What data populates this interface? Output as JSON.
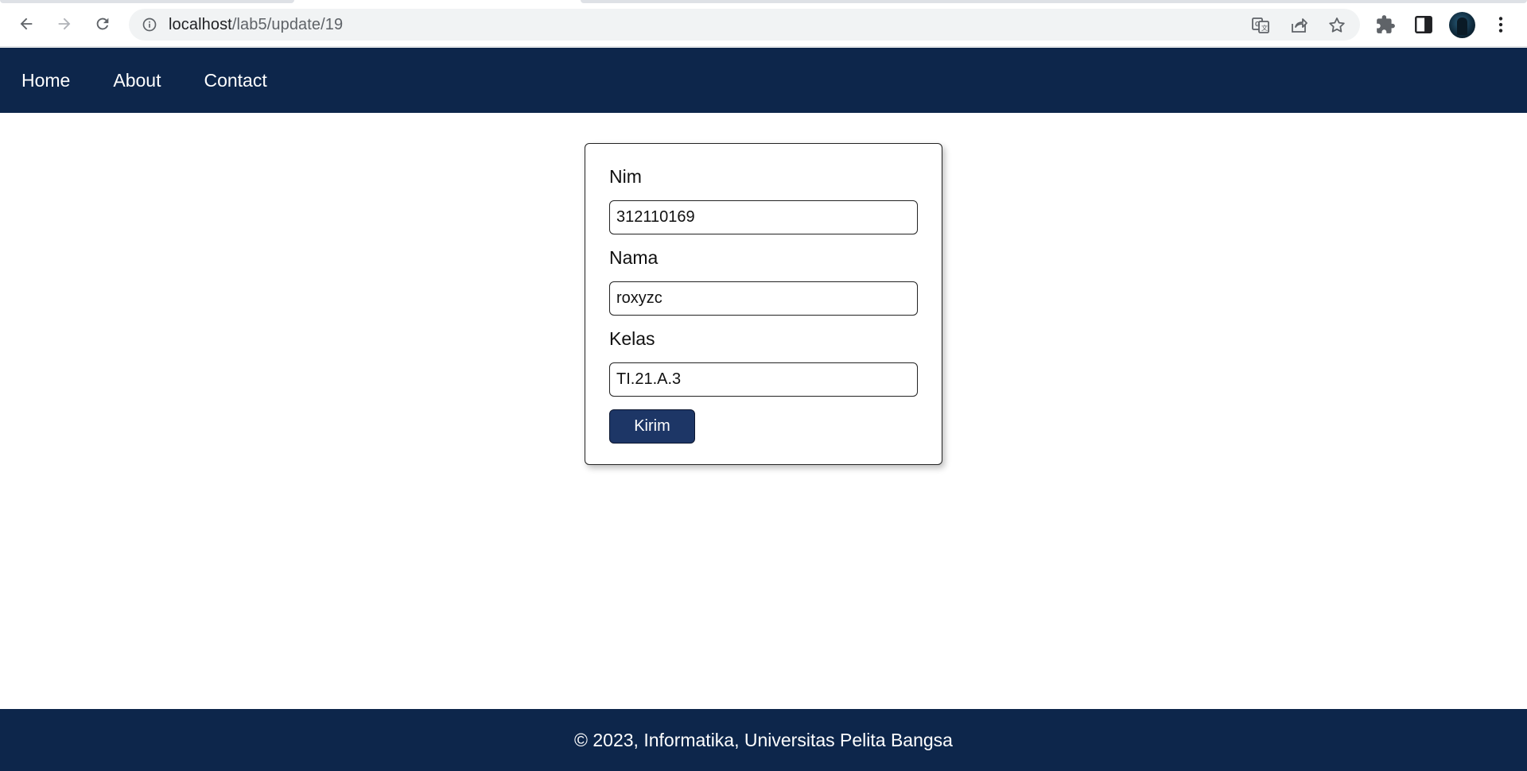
{
  "browser": {
    "url_host": "localhost",
    "url_path": "/lab5/update/19",
    "icons": [
      "back-arrow-icon",
      "forward-arrow-icon",
      "reload-icon",
      "site-info-icon",
      "translate-icon",
      "share-icon",
      "bookmark-star-icon",
      "extensions-puzzle-icon",
      "side-panel-icon",
      "profile-avatar",
      "more-menu-icon"
    ]
  },
  "nav": {
    "items": [
      {
        "label": "Home"
      },
      {
        "label": "About"
      },
      {
        "label": "Contact"
      }
    ]
  },
  "form": {
    "nim_label": "Nim",
    "nim_value": "312110169",
    "nama_label": "Nama",
    "nama_value": "roxyzc",
    "kelas_label": "Kelas",
    "kelas_value": "TI.21.A.3",
    "submit_label": "Kirim"
  },
  "footer": {
    "text": "© 2023, Informatika, Universitas Pelita Bangsa"
  },
  "colors": {
    "nav_bg": "#0d264b",
    "button_bg": "#1d3666"
  }
}
